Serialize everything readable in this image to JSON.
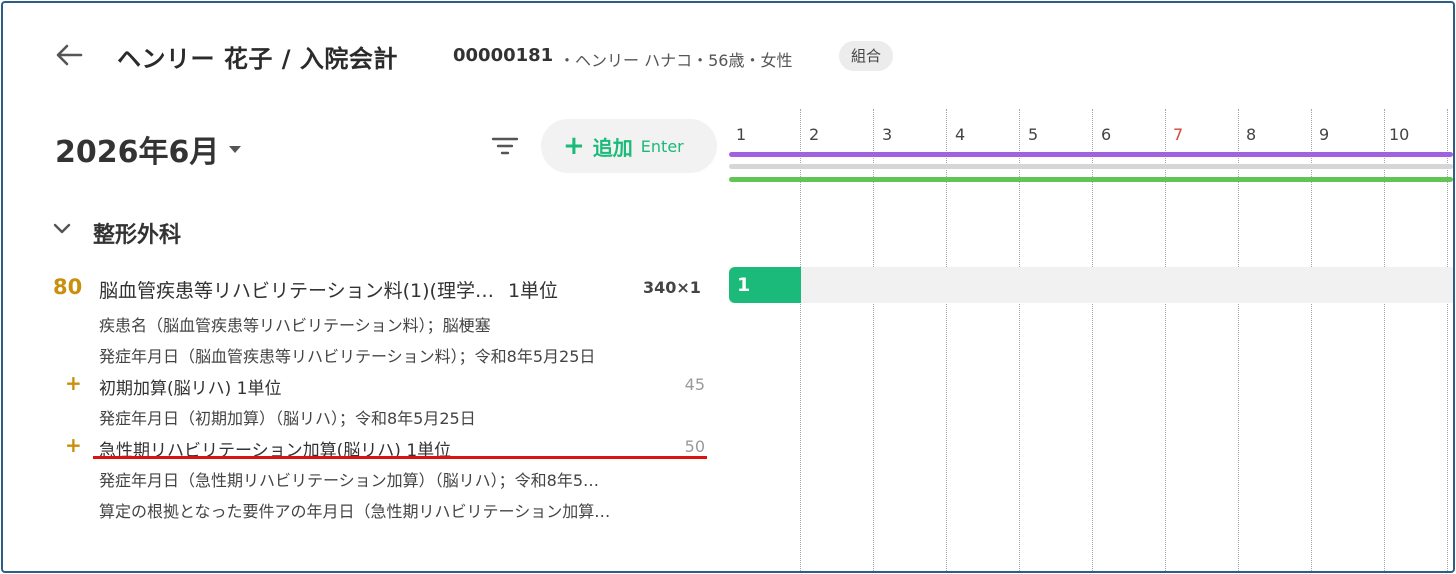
{
  "header": {
    "title": "ヘンリー 花子 / 入院会計",
    "patient_id": "00000181",
    "patient_info": "・ヘンリー ハナコ・56歳・女性",
    "insurance_badge": "組合"
  },
  "toolbar": {
    "month": "2026年6月",
    "add_label": "追加",
    "add_hint": "Enter"
  },
  "section": {
    "title": "整形外科"
  },
  "item": {
    "number": "80",
    "name": "脳血管疾患等リハビリテーション料(1)(理学…",
    "unit": "1単位",
    "price": "340×1",
    "details": [
      "疾患名（脳血管疾患等リハビリテーション料）；脳梗塞",
      "発症年月日（脳血管疾患等リハビリテーション料）；令和8年5月25日"
    ],
    "additions": [
      {
        "title": "初期加算(脳リハ) 1単位",
        "points": "45",
        "details": [
          "発症年月日（初期加算）（脳リハ）；令和8年5月25日"
        ]
      },
      {
        "title": "急性期リハビリテーション加算(脳リハ) 1単位",
        "points": "50",
        "details": [
          "発症年月日（急性期リハビリテーション加算）（脳リハ）；令和8年5…",
          "算定の根拠となった要件アの年月日（急性期リハビリテーション加算…"
        ]
      }
    ]
  },
  "timeline": {
    "days": [
      "1",
      "2",
      "3",
      "4",
      "5",
      "6",
      "7",
      "8",
      "9",
      "10"
    ],
    "weekend_color": "#d24a3a",
    "count_day1": "1",
    "bar_colors": [
      "#a162e0",
      "#d6d6d6",
      "#62c454"
    ]
  },
  "colors": {
    "accent_green": "#1bba7a",
    "item_gold": "#c8900e",
    "frame_border": "#2d5f86"
  }
}
